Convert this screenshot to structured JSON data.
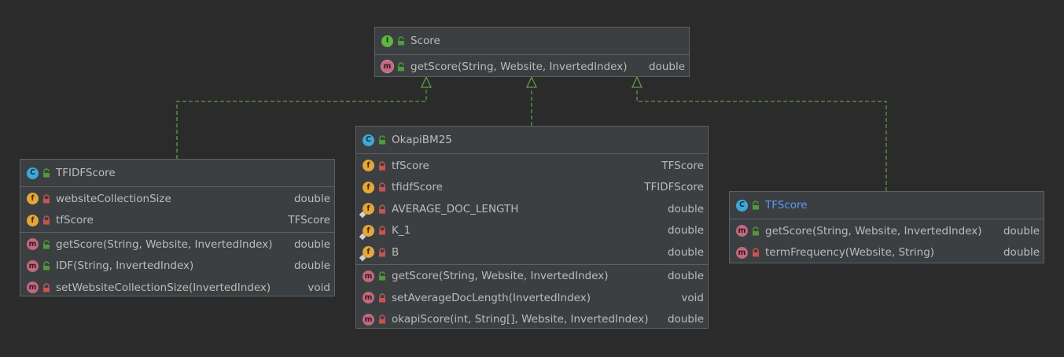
{
  "colors": {
    "background": "#2b2b2b",
    "box_fill": "#3c3f41",
    "border": "#5e6164",
    "text": "#bbbbbb",
    "link_text": "#589df6",
    "connector": "#5f9a4a",
    "interface_badge": "#62b543",
    "class_badge": "#40a8d8",
    "field_badge": "#e5a73a",
    "method_badge": "#c06a7d",
    "public_icon": "#4e9a3c",
    "private_icon": "#c75450"
  },
  "score": {
    "kind": "I",
    "name": "Score",
    "methods": [
      {
        "name": "getScore(String, Website, InvertedIndex)",
        "type": "double",
        "visibility": "public",
        "abstract": true
      }
    ]
  },
  "okapi": {
    "kind": "C",
    "name": "OkapiBM25",
    "fields": [
      {
        "name": "tfScore",
        "type": "TFScore",
        "visibility": "private"
      },
      {
        "name": "tfidfScore",
        "type": "TFIDFScore",
        "visibility": "private"
      },
      {
        "name": "AVERAGE_DOC_LENGTH",
        "type": "double",
        "visibility": "private",
        "static": true
      },
      {
        "name": "K_1",
        "type": "double",
        "visibility": "private",
        "static": true
      },
      {
        "name": "B",
        "type": "double",
        "visibility": "private",
        "static": true
      }
    ],
    "methods": [
      {
        "name": "getScore(String, Website, InvertedIndex)",
        "type": "double",
        "visibility": "public"
      },
      {
        "name": "setAverageDocLength(InvertedIndex)",
        "type": "void",
        "visibility": "private"
      },
      {
        "name": "okapiScore(int, String[], Website, InvertedIndex)",
        "type": "double",
        "visibility": "private"
      }
    ]
  },
  "tfidf": {
    "kind": "C",
    "name": "TFIDFScore",
    "fields": [
      {
        "name": "websiteCollectionSize",
        "type": "double",
        "visibility": "private"
      },
      {
        "name": "tfScore",
        "type": "TFScore",
        "visibility": "private"
      }
    ],
    "methods": [
      {
        "name": "getScore(String, Website, InvertedIndex)",
        "type": "double",
        "visibility": "public"
      },
      {
        "name": "IDF(String, InvertedIndex)",
        "type": "double",
        "visibility": "public"
      },
      {
        "name": "setWebsiteCollectionSize(InvertedIndex)",
        "type": "void",
        "visibility": "private"
      }
    ]
  },
  "tf": {
    "kind": "C",
    "name": "TFScore",
    "methods": [
      {
        "name": "getScore(String, Website, InvertedIndex)",
        "type": "double",
        "visibility": "public"
      },
      {
        "name": "termFrequency(Website, String)",
        "type": "double",
        "visibility": "private"
      }
    ]
  }
}
